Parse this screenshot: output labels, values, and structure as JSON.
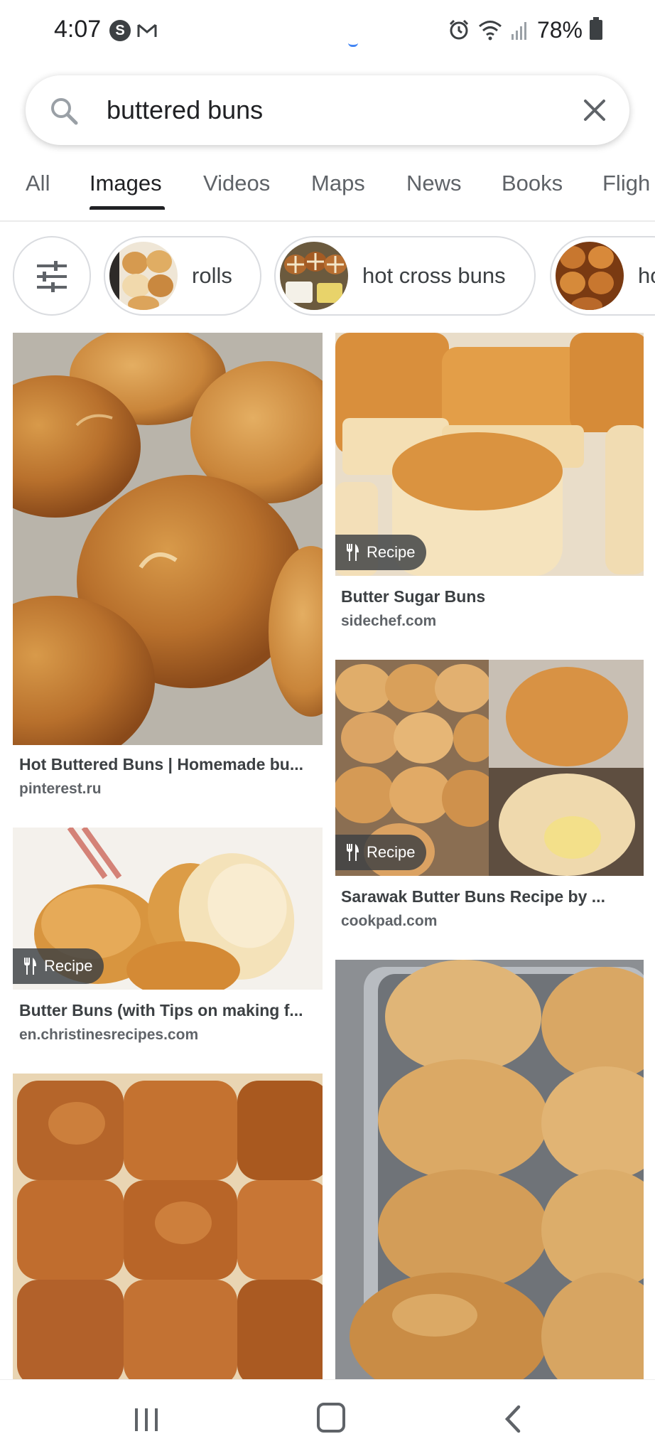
{
  "status_bar": {
    "time": "4:07",
    "s_icon_letter": "S",
    "battery": "78%"
  },
  "search": {
    "query": "buttered buns"
  },
  "tabs": [
    {
      "label": "All",
      "active": false
    },
    {
      "label": "Images",
      "active": true
    },
    {
      "label": "Videos",
      "active": false
    },
    {
      "label": "Maps",
      "active": false
    },
    {
      "label": "News",
      "active": false
    },
    {
      "label": "Books",
      "active": false
    },
    {
      "label": "Fligh",
      "active": false
    }
  ],
  "chips": [
    {
      "label": "rolls"
    },
    {
      "label": "hot cross buns"
    },
    {
      "label": "ho"
    }
  ],
  "results": [
    {
      "title": "Hot Buttered Buns | Homemade bu...",
      "source": "pinterest.ru",
      "recipe": false
    },
    {
      "title": "Butter Sugar Buns",
      "source": "sidechef.com",
      "recipe": true,
      "badge": "Recipe"
    },
    {
      "title": "Sarawak Butter Buns Recipe by ...",
      "source": "cookpad.com",
      "recipe": true,
      "badge": "Recipe"
    },
    {
      "title": "Butter Buns (with Tips on making f...",
      "source": "en.christinesrecipes.com",
      "recipe": true,
      "badge": "Recipe"
    }
  ],
  "colors": {
    "accent_blue": "#4285f4",
    "bun_golden": "#d8953f",
    "bun_dark": "#a85a1e",
    "bun_light": "#f3d9a6"
  },
  "icons": [
    "search-icon",
    "close-icon",
    "tune-icon",
    "fork-knife-icon",
    "alarm-icon",
    "wifi-icon",
    "signal-icon",
    "battery-icon",
    "recent-apps-icon",
    "home-icon",
    "back-icon"
  ]
}
